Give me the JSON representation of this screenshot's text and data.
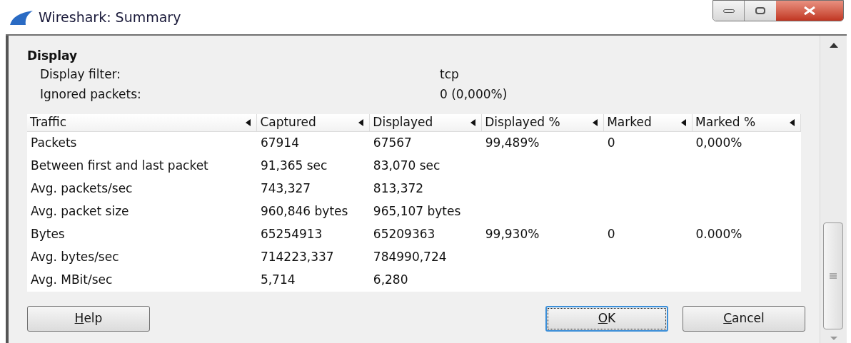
{
  "window": {
    "title": "Wireshark: Summary"
  },
  "display": {
    "heading": "Display",
    "fields": [
      {
        "label": "Display filter:",
        "value": "tcp"
      },
      {
        "label": "Ignored packets:",
        "value": "0 (0,000%)"
      }
    ]
  },
  "table": {
    "columns": [
      "Traffic",
      "Captured",
      "Displayed",
      "Displayed %",
      "Marked",
      "Marked %"
    ],
    "rows": [
      [
        "Packets",
        "67914",
        "67567",
        "99,489%",
        "0",
        "0,000%"
      ],
      [
        "Between first and last packet",
        "91,365 sec",
        "83,070 sec",
        "",
        "",
        ""
      ],
      [
        "Avg. packets/sec",
        "743,327",
        "813,372",
        "",
        "",
        ""
      ],
      [
        "Avg. packet size",
        "960,846 bytes",
        "965,107 bytes",
        "",
        "",
        ""
      ],
      [
        "Bytes",
        "65254913",
        "65209363",
        "99,930%",
        "0",
        "0.000%"
      ],
      [
        "Avg. bytes/sec",
        "714223,337",
        "784990,724",
        "",
        "",
        ""
      ],
      [
        "Avg. MBit/sec",
        "5,714",
        "6,280",
        "",
        "",
        ""
      ]
    ]
  },
  "buttons": [
    {
      "label": "Help",
      "mnemonic": true,
      "focused": false
    },
    {
      "label": "OK",
      "mnemonic": true,
      "focused": true
    },
    {
      "label": "Cancel",
      "mnemonic": true,
      "focused": false
    }
  ]
}
